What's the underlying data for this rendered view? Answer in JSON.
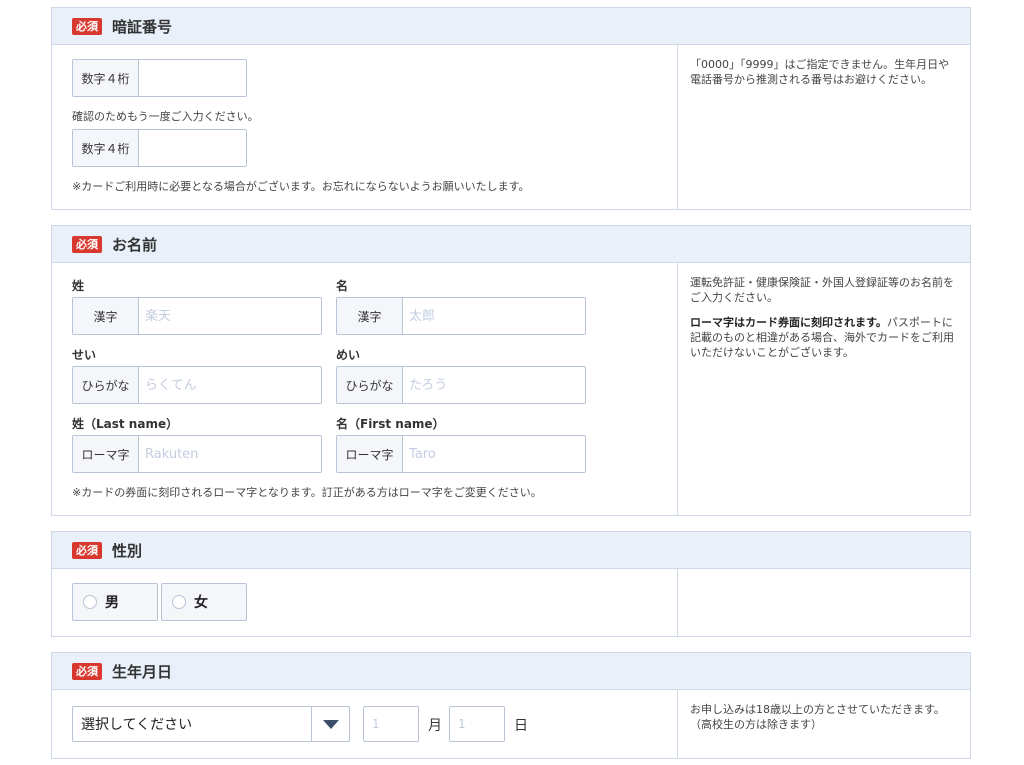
{
  "badge": "必須",
  "pin": {
    "title": "暗証番号",
    "field1_label": "数字４桁",
    "confirm_note": "確認のためもう一度ご入力ください。",
    "field2_label": "数字４桁",
    "bottom_note": "※カードご利用時に必要となる場合がございます。お忘れにならないようお願いいたします。",
    "side_text": "「0000」「9999」はご指定できません。生年月日や電話番号から推測される番号はお避けください。"
  },
  "name": {
    "title": "お名前",
    "sei_label": "姓",
    "mei_label": "名",
    "kanji_label": "漢字",
    "sei_kanji_placeholder": "楽天",
    "mei_kanji_placeholder": "太郎",
    "sei_kana_label": "せい",
    "mei_kana_label": "めい",
    "hiragana_label": "ひらがな",
    "sei_kana_placeholder": "らくてん",
    "mei_kana_placeholder": "たろう",
    "last_name_label": "姓（Last name）",
    "first_name_label": "名（First name）",
    "roman_label": "ローマ字",
    "last_name_placeholder": "Rakuten",
    "first_name_placeholder": "Taro",
    "bottom_note": "※カードの券面に刻印されるローマ字となります。訂正がある方はローマ字をご変更ください。",
    "side_text1": "運転免許証・健康保険証・外国人登録証等のお名前をご入力ください。",
    "side_bold": "ローマ字はカード券面に刻印されます。",
    "side_text2": "パスポートに記載のものと相違がある場合、海外でカードをご利用いただけないことがございます。"
  },
  "gender": {
    "title": "性別",
    "male": "男",
    "female": "女"
  },
  "birth": {
    "title": "生年月日",
    "year_select": "選択してください",
    "month_placeholder": "1",
    "month_unit": "月",
    "day_placeholder": "1",
    "day_unit": "日",
    "side_text": "お申し込みは18歳以上の方とさせていただきます。（高校生の方は除きます）"
  }
}
